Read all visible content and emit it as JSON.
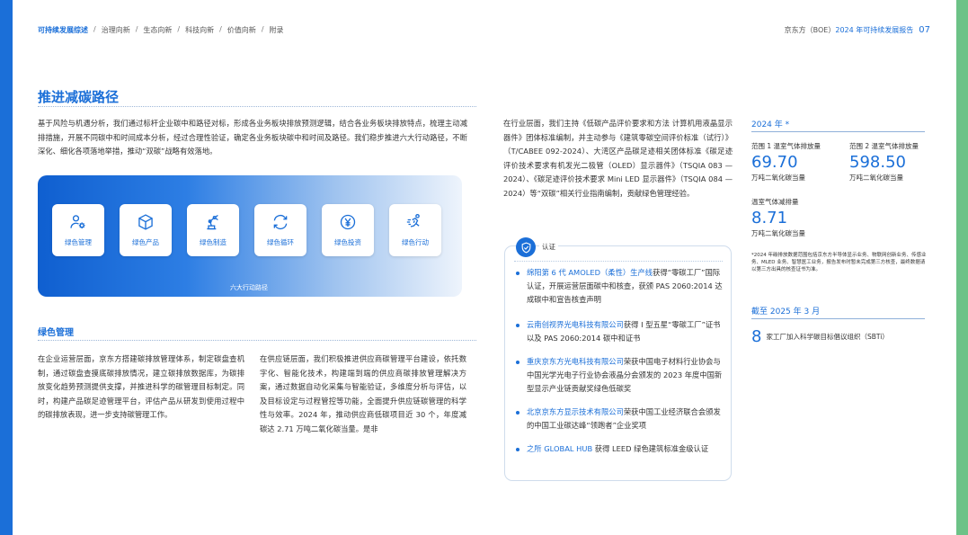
{
  "nav": {
    "items": [
      "可持续发展综述",
      "治理向新",
      "生态向新",
      "科技向新",
      "价值向新",
      "附录"
    ],
    "active_index": 0,
    "separator": "/"
  },
  "header": {
    "company": "京东方（BOE）",
    "year_report": "2024 年可持续发展报告",
    "page": "07"
  },
  "section": {
    "title": "推进减碳路径",
    "intro": "基于风险与机遇分析，我们通过标杆企业碳中和路径对标，形成各业务板块排放预测逻辑，结合各业务板块排放特点，梳理主动减排措施，开展不同碳中和时间成本分析，经过合理性验证，确定各业务板块碳中和时间及路径。我们稳步推进六大行动路径，不断深化、细化各项落地举措，推动“双碳”战略有效落地。"
  },
  "banner": {
    "caption": "六大行动路径",
    "paths": [
      {
        "label": "绿色管理",
        "icon": "people-gear-icon"
      },
      {
        "label": "绿色产品",
        "icon": "box-icon"
      },
      {
        "label": "绿色制造",
        "icon": "robot-arm-icon"
      },
      {
        "label": "绿色循环",
        "icon": "cycle-icon"
      },
      {
        "label": "绿色投资",
        "icon": "yuan-coin-icon"
      },
      {
        "label": "绿色行动",
        "icon": "runner-icon"
      }
    ]
  },
  "green_mgmt": {
    "title": "绿色管理",
    "col1": "在企业运营层面，京东方搭建碳排放管理体系，制定碳盘查机制，通过碳盘查摸底碳排放情况，建立碳排放数据库，为碳排放变化趋势预测提供支撑，并推进科学的碳管理目标制定。同时，构建产品碳足迹管理平台，评估产品从研发到使用过程中的碳排放表现，进一步支持碳管理工作。",
    "col2": "在供应链层面，我们积极推进供应商碳管理平台建设，依托数字化、智能化技术，构建端到端的供应商碳排放管理解决方案，通过数据自动化采集与智能验证，多维度分析与评估，以及目标设定与过程管控等功能，全面提升供应链碳管理的科学性与效率。2024 年，推动供应商低碳项目近 30 个，年度减碳达 2.71 万吨二氧化碳当量。是非",
    "col3": "在行业层面，我们主持《低碳产品评价要求和方法 计算机用液晶显示器件》团体标准编制，并主动参与《建筑零碳空间评价标准（试行）》（T/CABEE 092-2024）、大湾区产品碳足迹相关团体标准《碳足迹评价技术要求有机发光二极管（OLED）显示器件》（TSQIA 083 — 2024）、《碳足迹评价技术要求 Mini LED 显示器件》（TSQIA 084 — 2024）等“双碳”相关行业指南编制，贡献绿色管理经验。"
  },
  "cert": {
    "title": "认证",
    "items": [
      {
        "hl": "绵阳第 6 代 AMOLED（柔性）生产线",
        "rest": "获得“零碳工厂”国际认证，开展运营层面碳中和核查，获颁 PAS 2060:2014 达成碳中和宣告核查声明"
      },
      {
        "hl": "云南创视界光电科技有限公司",
        "rest": "获得 I 型五星“零碳工厂”证书以及 PAS 2060:2014 碳中和证书"
      },
      {
        "hl": "重庆京东方光电科技有限公司",
        "rest": "荣获中国电子材料行业协会与中国光学光电子行业协会液晶分会颁发的 2023 年度中国新型显示产业链贡献奖绿色低碳奖"
      },
      {
        "hl": "北京京东方显示技术有限公司",
        "rest": "荣获中国工业经济联合会颁发的中国工业碳达峰“领跑者”企业奖项"
      },
      {
        "hl": "之所 GLOBAL HUB",
        "rest": " 获得 LEED 绿色建筑标准金级认证"
      }
    ]
  },
  "kpis": {
    "year_label": "2024 年 *",
    "items": [
      {
        "label": "范围 1 温室气体排放量",
        "value": "69.70",
        "unit": "万吨二氧化碳当量"
      },
      {
        "label": "范围 2 温室气体排放量",
        "value": "598.50",
        "unit": "万吨二氧化碳当量"
      },
      {
        "label": "温室气体减排量",
        "value": "8.71",
        "unit": "万吨二氧化碳当量"
      }
    ],
    "note": "*2024 年碳排放数据范围包括京东方半导体显示业务、物联网创新业务、传感业务、MLED 业务、智慧医工业务，报告发布时暂未完成第三方核查，最终数据请以第三方出具的核查证书为准。"
  },
  "sbti": {
    "date_label": "截至 2025 年 3 月",
    "count": "8",
    "text": "家工厂加入科学碳目标倡议组织（SBTi）"
  },
  "colors": {
    "brand_blue": "#1b6fd8",
    "edge_green": "#6cc287"
  }
}
